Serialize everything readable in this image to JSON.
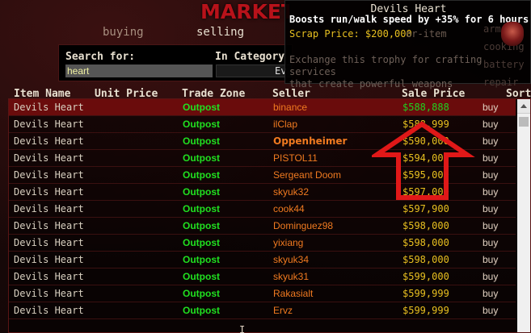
{
  "logo": {
    "text": "MARKETPLACE"
  },
  "tabs": {
    "buying": "buying",
    "selling": "selling"
  },
  "search": {
    "search_label": "Search for:",
    "category_label": "In Category",
    "value": "heart",
    "category_partial": "Ev"
  },
  "headers": {
    "item_name": "Item Name",
    "unit_price": "Unit Price",
    "trade_zone": "Trade Zone",
    "seller": "Seller",
    "sale_price": "Sale Price",
    "sort": "Sort"
  },
  "rows": [
    {
      "name": "Devils Heart",
      "zone": "Outpost",
      "seller": "binance",
      "price": "$588,888",
      "buy": "buy",
      "bold": false
    },
    {
      "name": "Devils Heart",
      "zone": "Outpost",
      "seller": "ilClap",
      "price": "$588,999",
      "buy": "buy",
      "bold": false
    },
    {
      "name": "Devils Heart",
      "zone": "Outpost",
      "seller": "Oppenheimer",
      "price": "$590,000",
      "buy": "buy",
      "bold": true
    },
    {
      "name": "Devils Heart",
      "zone": "Outpost",
      "seller": "PISTOL11",
      "price": "$594,000",
      "buy": "buy",
      "bold": false
    },
    {
      "name": "Devils Heart",
      "zone": "Outpost",
      "seller": "Sergeant Doom",
      "price": "$595,000",
      "buy": "buy",
      "bold": false
    },
    {
      "name": "Devils Heart",
      "zone": "Outpost",
      "seller": "skyuk32",
      "price": "$597,000",
      "buy": "buy",
      "bold": false
    },
    {
      "name": "Devils Heart",
      "zone": "Outpost",
      "seller": "cook44",
      "price": "$597,900",
      "buy": "buy",
      "bold": false
    },
    {
      "name": "Devils Heart",
      "zone": "Outpost",
      "seller": "Dominguez98",
      "price": "$598,000",
      "buy": "buy",
      "bold": false
    },
    {
      "name": "Devils Heart",
      "zone": "Outpost",
      "seller": "yixiang",
      "price": "$598,000",
      "buy": "buy",
      "bold": false
    },
    {
      "name": "Devils Heart",
      "zone": "Outpost",
      "seller": "skyuk34",
      "price": "$598,000",
      "buy": "buy",
      "bold": false
    },
    {
      "name": "Devils Heart",
      "zone": "Outpost",
      "seller": "skyuk31",
      "price": "$599,000",
      "buy": "buy",
      "bold": false
    },
    {
      "name": "Devils Heart",
      "zone": "Outpost",
      "seller": "Rakasialt",
      "price": "$599,999",
      "buy": "buy",
      "bold": false
    },
    {
      "name": "Devils Heart",
      "zone": "Outpost",
      "seller": "Ervz",
      "price": "$599,999",
      "buy": "buy",
      "bold": false
    }
  ],
  "tooltip": {
    "title": "Devils Heart",
    "desc": "Boosts run/walk speed by +35% for 6 hours",
    "scrap": "Scrap Price: $200,000",
    "bg_text": "or-item",
    "exchange_line1": "Exchange this trophy for crafting services",
    "exchange_line2": "that create powerful weapons",
    "cat_bg": [
      "armor",
      "cooking",
      "battery",
      "repair"
    ]
  },
  "colors": {
    "highlight": "#6a0c0c",
    "zone": "#20e020",
    "seller": "#f07a20",
    "price": "#e8c020",
    "arrow": "#e01818"
  }
}
